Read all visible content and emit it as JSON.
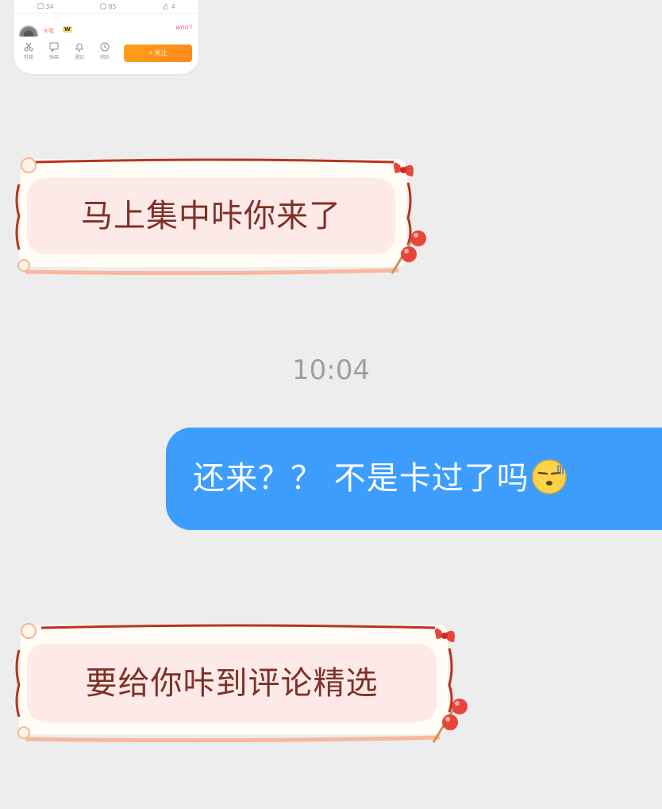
{
  "shared_card": {
    "stats": [
      {
        "icon": "comment-icon",
        "count": "34"
      },
      {
        "icon": "share-icon",
        "count": "85"
      },
      {
        "icon": "thumbs-up-icon",
        "count": "4"
      }
    ],
    "author_name": "卡我",
    "author_tag": "W",
    "scribble": "who'l",
    "actions": [
      {
        "icon": "scissors-icon",
        "label": "剪辑"
      },
      {
        "icon": "danmaku-icon",
        "label": "弹幕"
      },
      {
        "icon": "bell-icon",
        "label": "通知"
      },
      {
        "icon": "clock-icon",
        "label": "稍后"
      }
    ],
    "follow_label": "+ 关注"
  },
  "messages": [
    {
      "direction": "incoming",
      "text": "马上集中咔你来了"
    },
    {
      "direction": "outgoing",
      "text": "还来？？ 不是卡过了吗",
      "emoji": "smirk-emoji"
    },
    {
      "direction": "incoming",
      "text": "要给你咔到评论精选"
    }
  ],
  "timestamp": "10:04",
  "colors": {
    "background": "#ededed",
    "outgoing_bubble": "#3d9dfc",
    "incoming_text": "#7e3126",
    "incoming_fill": "#fde9e7",
    "frame_red": "#b8341e",
    "follow_orange": "#ff9a1a"
  }
}
